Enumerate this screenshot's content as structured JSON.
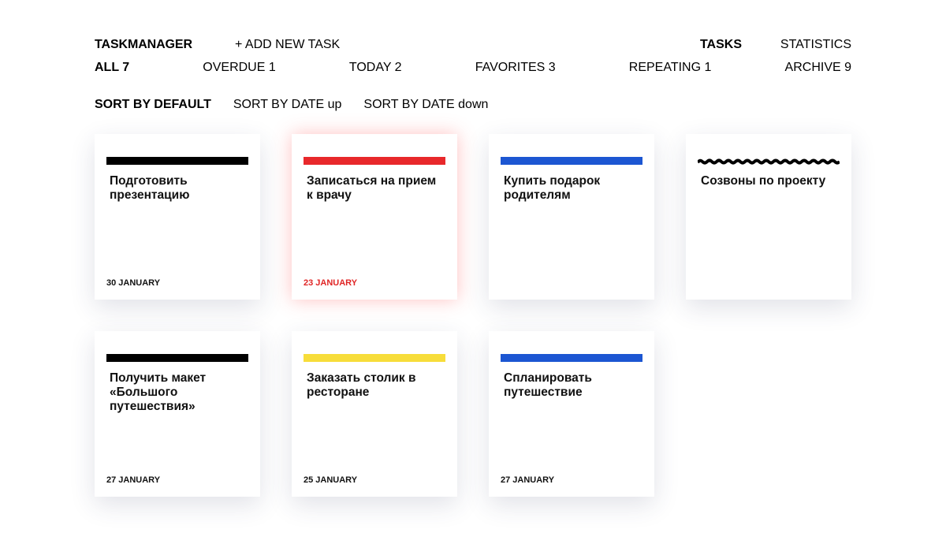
{
  "header": {
    "brand": "TASKMANAGER",
    "add_task": "+ ADD NEW TASK",
    "nav": {
      "tasks": "TASKS",
      "statistics": "STATISTICS"
    }
  },
  "filters": [
    {
      "label": "ALL 7",
      "active": true
    },
    {
      "label": "OVERDUE 1",
      "active": false
    },
    {
      "label": "TODAY 2",
      "active": false
    },
    {
      "label": "FAVORITES 3",
      "active": false
    },
    {
      "label": "REPEATING 1",
      "active": false
    },
    {
      "label": "ARCHIVE 9",
      "active": false
    }
  ],
  "sorts": [
    {
      "label": "SORT BY DEFAULT",
      "active": true
    },
    {
      "label": "SORT BY DATE up",
      "active": false
    },
    {
      "label": "SORT BY DATE down",
      "active": false
    }
  ],
  "colors": {
    "black": "#000000",
    "red": "#e8282b",
    "blue": "#1c56d2",
    "yellow": "#f7dd3a",
    "deadline_text": "#e02525"
  },
  "cards": [
    {
      "title": "Подготовить презентацию",
      "date": "30 JANUARY",
      "color": "#000000",
      "repeating": false,
      "deadline": false
    },
    {
      "title": "Записаться на прием к врачу",
      "date": "23 JANUARY",
      "color": "#e8282b",
      "repeating": false,
      "deadline": true
    },
    {
      "title": "Купить подарок родителям",
      "date": "",
      "color": "#1c56d2",
      "repeating": false,
      "deadline": false
    },
    {
      "title": "Созвоны по проекту",
      "date": "",
      "color": "#000000",
      "repeating": true,
      "deadline": false
    },
    {
      "title": "Получить макет «Большого путешествия»",
      "date": "27 JANUARY",
      "color": "#000000",
      "repeating": false,
      "deadline": false
    },
    {
      "title": "Заказать столик в ресторане",
      "date": "25 JANUARY",
      "color": "#f7dd3a",
      "repeating": false,
      "deadline": false
    },
    {
      "title": "Спланировать путешествие",
      "date": "27 JANUARY",
      "color": "#1c56d2",
      "repeating": false,
      "deadline": false
    }
  ]
}
